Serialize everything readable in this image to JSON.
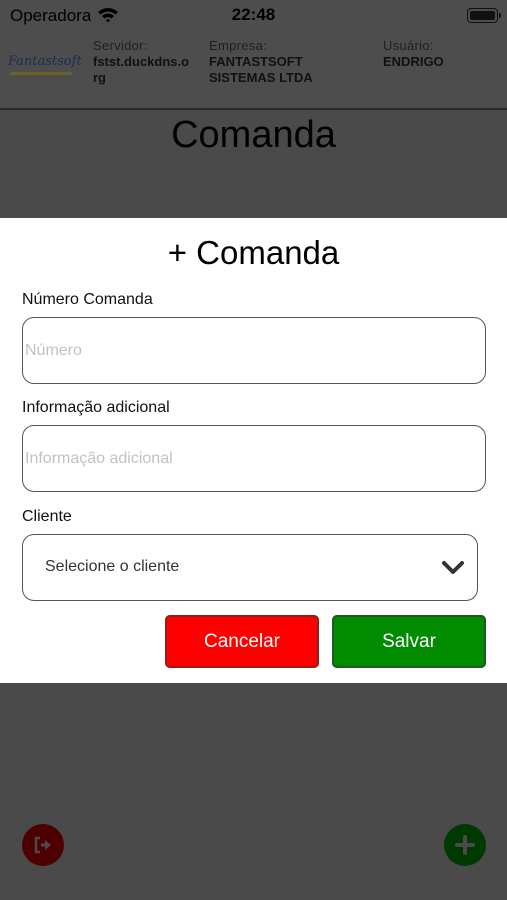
{
  "status_bar": {
    "carrier": "Operadora",
    "time": "22:48"
  },
  "header": {
    "logo_text": "Fantastsoft",
    "servidor_label": "Servidor:",
    "servidor_value_line1": "fstst.duckdns.o",
    "servidor_value_line2": "rg",
    "empresa_label": "Empresa:",
    "empresa_value_line1": "FANTASTSOFT",
    "empresa_value_line2": "SISTEMAS LTDA",
    "usuario_label": "Usuário:",
    "usuario_value": "ENDRIGO"
  },
  "page": {
    "title": "Comanda"
  },
  "modal": {
    "title": "+ Comanda",
    "numero_label": "Número Comanda",
    "numero_placeholder": "Número",
    "numero_value": "",
    "info_label": "Informação adicional",
    "info_placeholder": "Informação adicional",
    "info_value": "",
    "cliente_label": "Cliente",
    "cliente_selected": "Selecione o cliente",
    "cancel_label": "Cancelar",
    "save_label": "Salvar"
  },
  "icons": {
    "exit": "exit-icon",
    "add": "plus-icon",
    "chevron": "chevron-down-icon",
    "wifi": "wifi-icon",
    "battery": "battery-icon"
  },
  "colors": {
    "cancel": "#ff0000",
    "save": "#008b00",
    "overlay": "#4a4a4a"
  }
}
